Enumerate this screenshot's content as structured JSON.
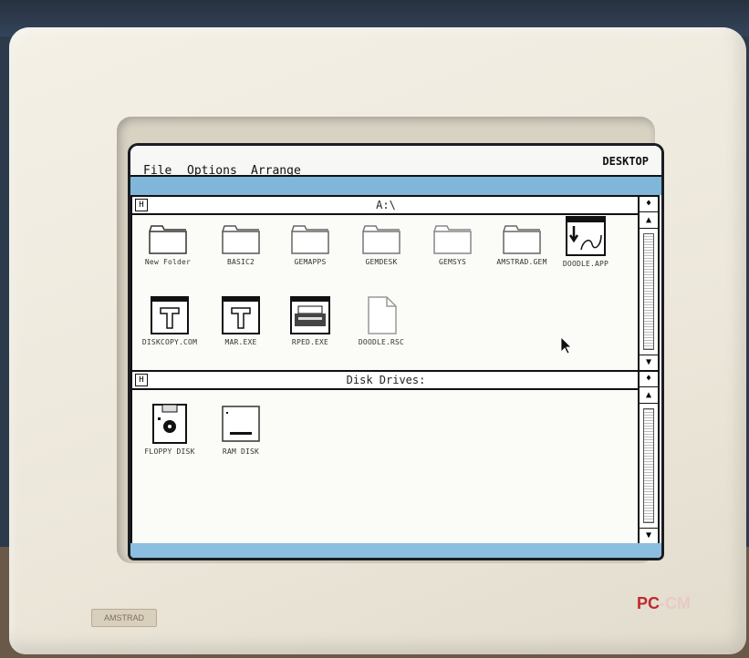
{
  "menubar": {
    "items": [
      "File",
      "Options",
      "Arrange"
    ],
    "desktop_label": "DESKTOP"
  },
  "top_window": {
    "title": "A:\\",
    "close_glyph": "H",
    "icons": [
      {
        "label": "New Folder",
        "type": "folder-icon"
      },
      {
        "label": "BASIC2",
        "type": "folder-icon"
      },
      {
        "label": "GEMAPPS",
        "type": "folder-icon"
      },
      {
        "label": "GEMDESK",
        "type": "folder-icon"
      },
      {
        "label": "GEMSYS",
        "type": "folder-icon"
      },
      {
        "label": "AMSTRAD.GEM",
        "type": "folder-icon"
      },
      {
        "label": "DOODLE.APP",
        "type": "app-icon"
      },
      {
        "label": "DISKCOPY.COM",
        "type": "tool-icon"
      },
      {
        "label": "MAR.EXE",
        "type": "tool-icon"
      },
      {
        "label": "RPED.EXE",
        "type": "printer-icon"
      },
      {
        "label": "DOODLE.RSC",
        "type": "document-icon"
      }
    ]
  },
  "bottom_window": {
    "title": "Disk Drives:",
    "close_glyph": "H",
    "icons": [
      {
        "label": "FLOPPY DISK",
        "type": "floppy-disk-icon"
      },
      {
        "label": "RAM DISK",
        "type": "ram-disk-icon"
      }
    ]
  },
  "scrollbar": {
    "up_glyph": "▲",
    "down_glyph": "▼",
    "top_glyph": "♦"
  },
  "bezel": {
    "brand_pc": "PC",
    "brand_cm": "-CM",
    "plate_text": "AMSTRAD"
  },
  "colors": {
    "desktop": "#7fb6d9",
    "window": "#fbfbf7",
    "brand_red": "#c0282d"
  }
}
